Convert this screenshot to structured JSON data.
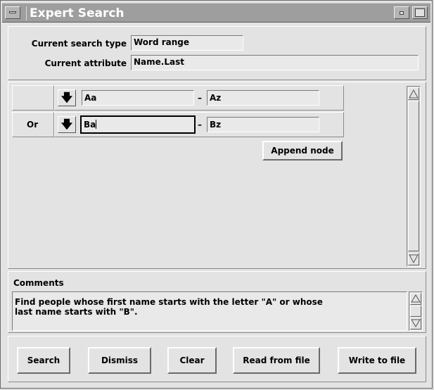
{
  "window": {
    "title": "Expert Search"
  },
  "search": {
    "type_label": "Current search type",
    "type_value": "Word range",
    "attr_label": "Current attribute",
    "attr_value": "Name.Last"
  },
  "nodes": [
    {
      "op": "",
      "from": "Aa",
      "dash": "–",
      "to": "Az"
    },
    {
      "op": "Or",
      "from": "Ba",
      "dash": "–",
      "to": "Bz"
    }
  ],
  "append_label": "Append node",
  "comments": {
    "label": "Comments",
    "text": "Find people whose first name starts with the letter \"A\" or whose\nlast name starts with \"B\"."
  },
  "buttons": {
    "search": "Search",
    "dismiss": "Dismiss",
    "clear": "Clear",
    "read": "Read from file",
    "write": "Write to file"
  },
  "icons": {
    "arrow": "down-arrow-icon",
    "menu": "window-menu-icon",
    "minimize": "minimize-icon",
    "maximize": "maximize-icon"
  }
}
